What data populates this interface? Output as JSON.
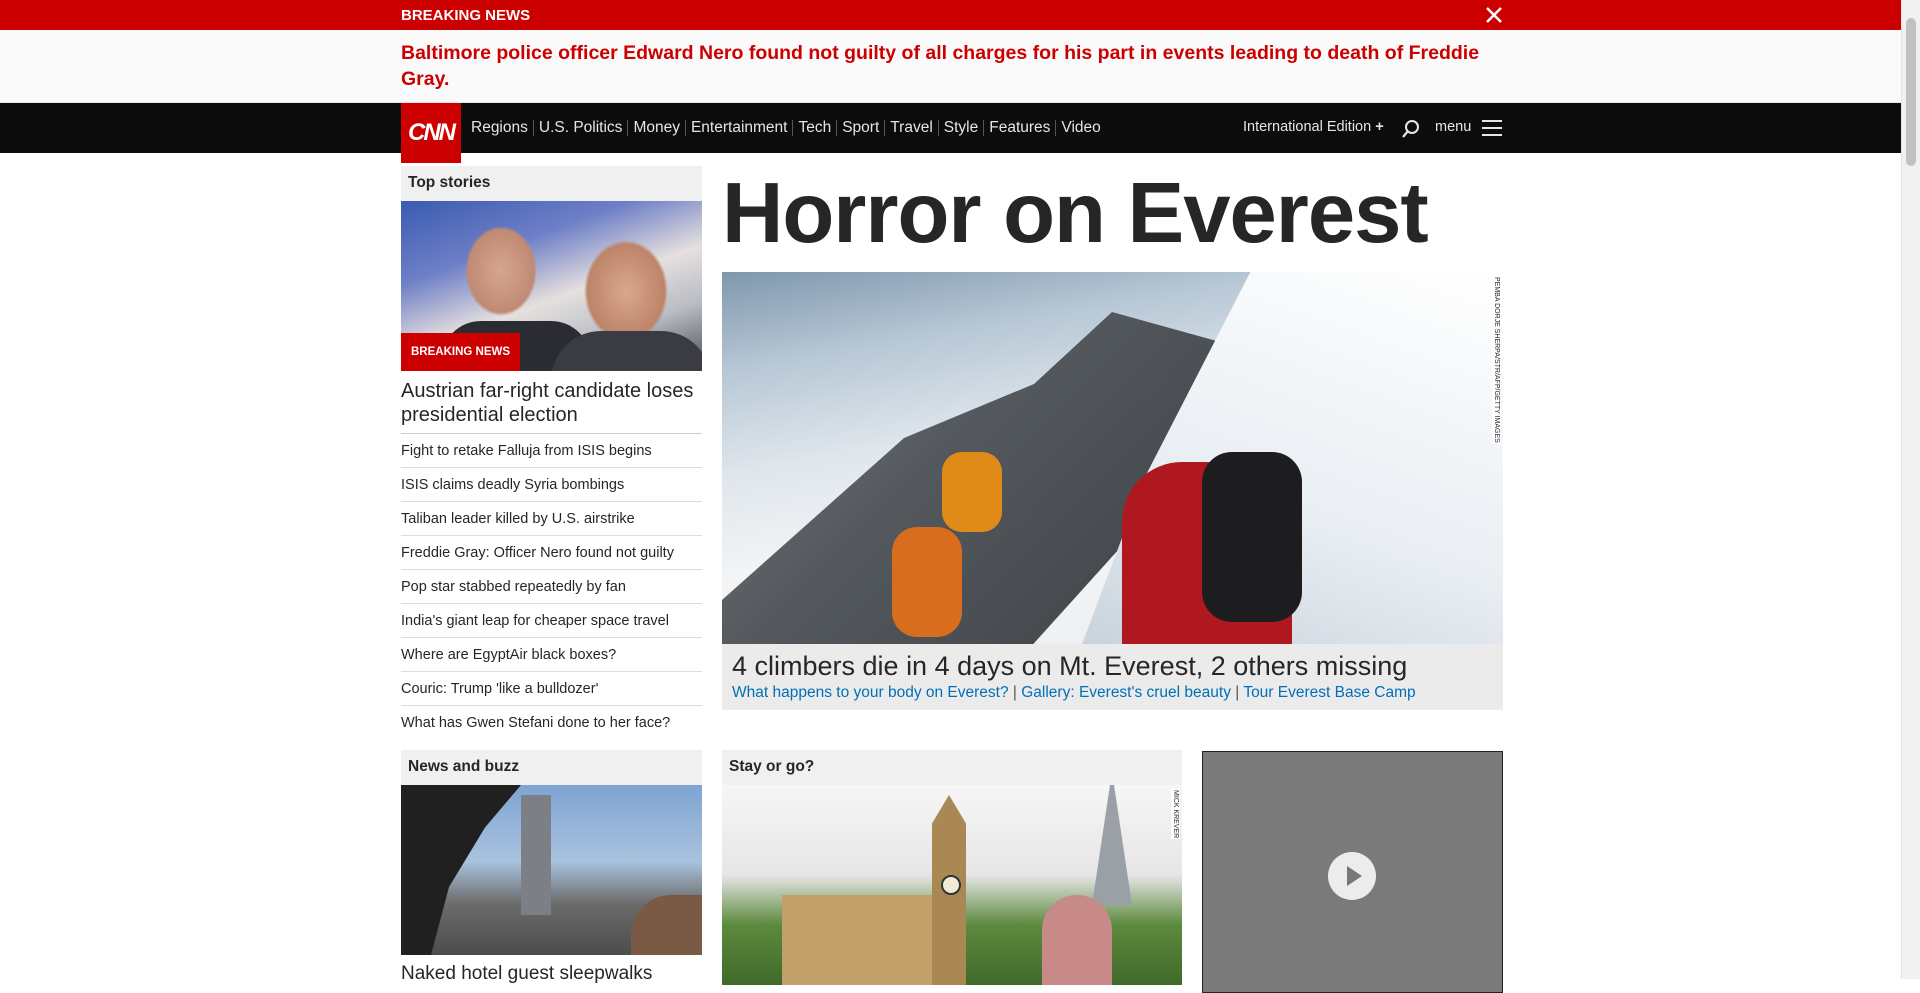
{
  "breaking_banner": {
    "label": "BREAKING NEWS",
    "headline": "Baltimore police officer Edward Nero found not guilty of all charges for his part in events leading to death of Freddie Gray."
  },
  "nav": {
    "logo": "CNN",
    "items": [
      "Regions",
      "U.S. Politics",
      "Money",
      "Entertainment",
      "Tech",
      "Sport",
      "Travel",
      "Style",
      "Features",
      "Video"
    ],
    "edition": "International Edition",
    "edition_plus": "+",
    "menu_label": "menu"
  },
  "top_stories": {
    "header": "Top stories",
    "image_tag": "BREAKING NEWS",
    "lead": "Austrian far-right candidate loses presidential election",
    "stories": [
      "Fight to retake Falluja from ISIS begins",
      "ISIS claims deadly Syria bombings",
      "Taliban leader killed by U.S. airstrike",
      "Freddie Gray: Officer Nero found not guilty",
      "Pop star stabbed repeatedly by fan",
      "India's giant leap for cheaper space travel",
      "Where are EgyptAir black boxes?",
      "Couric: Trump 'like a bulldozer'",
      "What has Gwen Stefani done to her face?"
    ]
  },
  "hero": {
    "title": "Horror on Everest",
    "photo_credit": "PEMBA DORJE SHERPA/STR/AFP/GETTY IMAGES",
    "headline": "4 climbers die in 4 days on Mt. Everest, 2 others missing",
    "links": [
      "What happens to your body on Everest?",
      "Gallery: Everest's cruel beauty",
      "Tour Everest Base Camp"
    ],
    "separator": " | "
  },
  "news_buzz": {
    "header": "News and buzz",
    "headline": "Naked hotel guest sleepwalks"
  },
  "stay_or_go": {
    "header": "Stay or go?",
    "photo_credit": "MICK KREVER"
  },
  "colors": {
    "brand_red": "#cc0000",
    "nav_bg": "#0c0c0c",
    "link_blue": "#006fb8"
  }
}
